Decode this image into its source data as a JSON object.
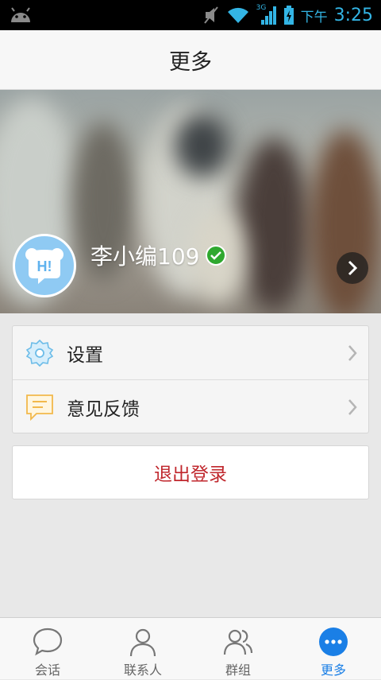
{
  "status_bar": {
    "ampm": "下午",
    "time": "3:25",
    "network_label": "3G"
  },
  "header": {
    "title": "更多"
  },
  "profile": {
    "name": "李小编109",
    "avatar_text": "H!",
    "verified": true
  },
  "menu": {
    "items": [
      {
        "label": "设置",
        "icon": "gear-icon"
      },
      {
        "label": "意见反馈",
        "icon": "feedback-icon"
      }
    ]
  },
  "logout": {
    "label": "退出登录"
  },
  "tabbar": {
    "tabs": [
      {
        "label": "会话",
        "icon": "chat-bubble-icon"
      },
      {
        "label": "联系人",
        "icon": "person-icon"
      },
      {
        "label": "群组",
        "icon": "group-icon"
      },
      {
        "label": "更多",
        "icon": "more-icon"
      }
    ],
    "active_index": 3
  },
  "colors": {
    "accent": "#1a7fe6",
    "status_blue": "#33b5e5",
    "logout_red": "#c0272d",
    "verified_green": "#2fa82f"
  }
}
